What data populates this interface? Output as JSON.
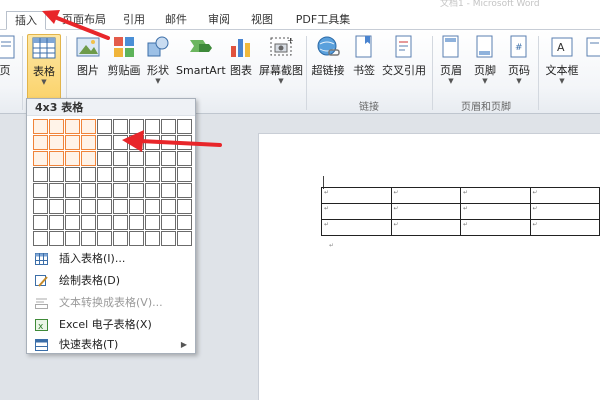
{
  "window": {
    "title": "文档1 - Microsoft Word"
  },
  "tabs": [
    {
      "label": "插入",
      "active": true
    },
    {
      "label": "页面布局"
    },
    {
      "label": "引用"
    },
    {
      "label": "邮件"
    },
    {
      "label": "审阅"
    },
    {
      "label": "视图"
    },
    {
      "label": "PDF工具集"
    }
  ],
  "ribbon": {
    "pages": {
      "label": "页"
    },
    "tables": {
      "table_label": "表格"
    },
    "illustrations": {
      "picture": "图片",
      "clipart": "剪贴画",
      "shapes": "形状",
      "smartart": "SmartArt",
      "chart": "图表",
      "screenshot": "屏幕截图"
    },
    "links": {
      "hyperlink": "超链接",
      "bookmark": "书签",
      "crossref": "交叉引用",
      "group_label": "链接"
    },
    "header_footer": {
      "header": "页眉",
      "footer": "页脚",
      "page_number": "页码",
      "group_label": "页眉和页脚"
    },
    "text": {
      "textbox": "文本框"
    }
  },
  "table_dropdown": {
    "header": "4x3 表格",
    "grid": {
      "columns": 10,
      "rows": 8,
      "highlight_cols": 4,
      "highlight_rows": 3
    },
    "menu": [
      {
        "label": "插入表格(I)...",
        "icon": "insert-table-icon",
        "disabled": false
      },
      {
        "label": "绘制表格(D)",
        "icon": "draw-table-icon",
        "disabled": false
      },
      {
        "label": "文本转换成表格(V)...",
        "icon": "convert-text-icon",
        "disabled": true
      },
      {
        "label": "Excel 电子表格(X)",
        "icon": "excel-icon",
        "disabled": false
      },
      {
        "label": "快速表格(T)",
        "icon": "quick-table-icon",
        "disabled": false,
        "submenu": true
      }
    ]
  },
  "document": {
    "table": {
      "rows": 3,
      "cols": 4
    },
    "cell_mark": "↵"
  },
  "colors": {
    "accent_orange": "#f0843a",
    "annotation_red": "#e8262a",
    "pressed_gold": "#fbd36b"
  }
}
